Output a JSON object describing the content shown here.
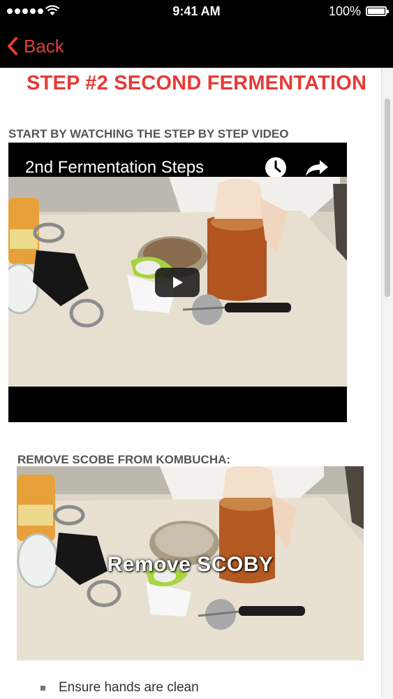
{
  "status_bar": {
    "time": "9:41 AM",
    "battery": "100%"
  },
  "nav": {
    "back_label": "Back"
  },
  "page": {
    "title": "STEP #2 SECOND FERMENTATION"
  },
  "sections": {
    "video_heading": "START BY WATCHING THE STEP BY STEP VIDEO",
    "video_title": "2nd Fermentation Steps",
    "remove_heading": "REMOVE SCOBE FROM KOMBUCHA:",
    "image_overlay": "Remove SCOBY"
  },
  "bullets": [
    "Ensure hands are clean"
  ],
  "icons": {
    "back": "chevron-left-icon",
    "watch_later": "clock-icon",
    "share": "share-icon",
    "play": "play-icon"
  },
  "colors": {
    "accent": "#e63a36",
    "nav_background": "#000000",
    "heading": "#555555"
  }
}
